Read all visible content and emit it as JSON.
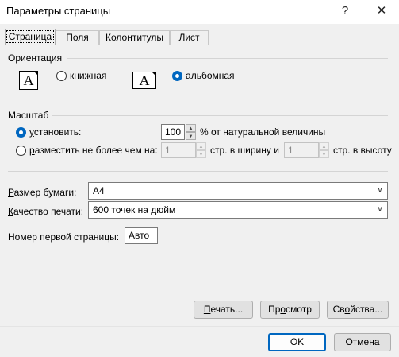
{
  "window": {
    "title": "Параметры страницы",
    "help_glyph": "?",
    "close_glyph": "✕"
  },
  "tabs": [
    {
      "label": "Страница",
      "active": true
    },
    {
      "label": "Поля",
      "active": false
    },
    {
      "label": "Колонтитулы",
      "active": false
    },
    {
      "label": "Лист",
      "active": false
    }
  ],
  "orientation": {
    "label": "Ориентация",
    "portrait_label": "книжная",
    "landscape_label": "альбомная",
    "selected": "landscape",
    "icon_glyph": "A"
  },
  "scale": {
    "label": "Масштаб",
    "adjust_label": "установить:",
    "adjust_value": "100",
    "adjust_suffix": "% от натуральной величины",
    "fit_label": "разместить не более чем на:",
    "fit_wide_value": "1",
    "fit_wide_suffix": "стр. в ширину и",
    "fit_tall_value": "1",
    "fit_tall_suffix": "стр. в высоту",
    "selected": "adjust",
    "spin_up_glyph": "▲",
    "spin_down_glyph": "▼"
  },
  "paper": {
    "size_label": "Размер бумаги:",
    "size_value": "A4",
    "quality_label": "Качество печати:",
    "quality_value": "600 точек на дюйм",
    "first_page_label": "Номер первой страницы:",
    "first_page_value": "Авто",
    "dropdown_glyph": "∨"
  },
  "buttons": {
    "print": "Печать...",
    "preview": "Просмотр",
    "options": "Свойства...",
    "ok": "OK",
    "cancel": "Отмена"
  },
  "colors": {
    "accent": "#0067c0",
    "background": "#f0f0f0"
  }
}
